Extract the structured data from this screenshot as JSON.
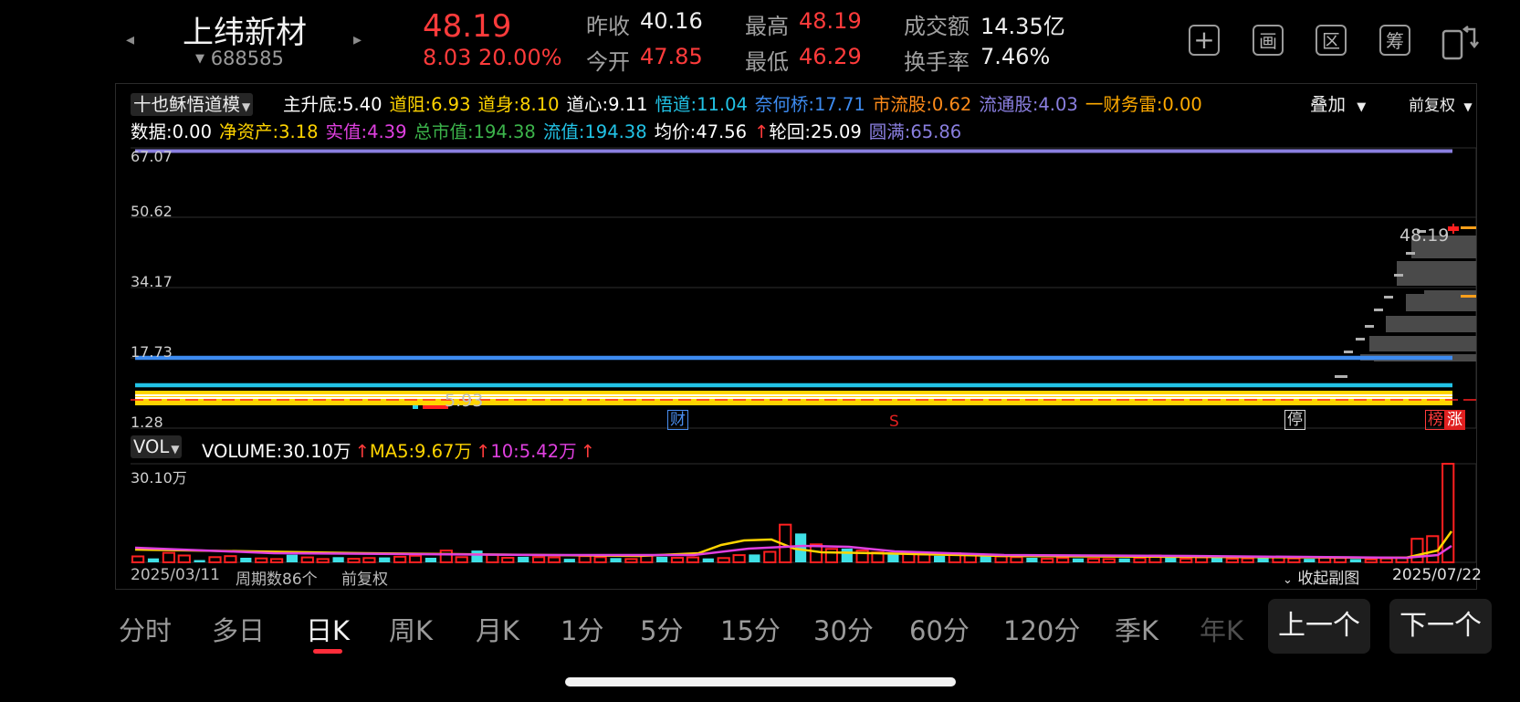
{
  "stock": {
    "name": "上纬新材",
    "code": "688585",
    "price": "48.19",
    "change": "8.03",
    "change_pct": "20.00%",
    "stats": [
      {
        "label": "昨收",
        "value": "40.16",
        "color": "#eeeeee"
      },
      {
        "label": "今开",
        "value": "47.85",
        "color": "#ff3b3b"
      },
      {
        "label": "最高",
        "value": "48.19",
        "color": "#ff3b3b"
      },
      {
        "label": "最低",
        "value": "46.29",
        "color": "#ff3b3b"
      },
      {
        "label": "成交额",
        "value": "14.35亿",
        "color": "#eeeeee"
      },
      {
        "label": "换手率",
        "value": "7.46%",
        "color": "#eeeeee"
      }
    ]
  },
  "toolbar": {
    "add_glyph": "+",
    "btn_picture": "画",
    "btn_interval": "区",
    "btn_chips": "筹"
  },
  "indicator": {
    "selector": "十也稣悟道模",
    "row1": [
      {
        "text": "主升底:5.40",
        "color": "#ffffff"
      },
      {
        "text": "道阻:6.93",
        "color": "#ffd400"
      },
      {
        "text": "道身:8.10",
        "color": "#ffd400"
      },
      {
        "text": "道心:9.11",
        "color": "#ffffff"
      },
      {
        "text": "悟道:11.04",
        "color": "#22c3e6"
      },
      {
        "text": "奈何桥:17.71",
        "color": "#3d8bf0"
      },
      {
        "text": "市流股:0.62",
        "color": "#ff8c1a"
      },
      {
        "text": "流通股:4.03",
        "color": "#8a7fe0"
      },
      {
        "text": "一财务雷:0.00",
        "color": "#ffaa00"
      }
    ],
    "row2": [
      {
        "text": "数据:0.00",
        "color": "#ffffff"
      },
      {
        "text": "净资产:3.18",
        "color": "#ffd400"
      },
      {
        "text": "实值:4.39",
        "color": "#e040e0"
      },
      {
        "text": "总市值:194.38",
        "color": "#3cb44b"
      },
      {
        "text": "流值:194.38",
        "color": "#22c3e6"
      },
      {
        "text": "均价:47.56",
        "color": "#ffffff"
      },
      {
        "text": "↑",
        "color": "#ff3b3b"
      },
      {
        "text": "轮回:25.09",
        "color": "#ffffff"
      },
      {
        "text": "圆满:65.86",
        "color": "#8a7fe0"
      }
    ],
    "overlay": "叠加",
    "adjust": "前复权"
  },
  "main_axis": {
    "labels": [
      "67.07",
      "50.62",
      "34.17",
      "17.73",
      "1.28"
    ],
    "last_price_label": "48.19",
    "low_label": "5.93"
  },
  "markers": {
    "cai": "财",
    "s": "S",
    "ting": "停",
    "bang": "榜",
    "zhang": "涨"
  },
  "volume": {
    "selector": "VOL",
    "legend": [
      {
        "text": "VOLUME:30.10万",
        "color": "#ffffff"
      },
      {
        "text": "↑",
        "color": "#ff3b3b"
      },
      {
        "text": "MA5:9.67万",
        "color": "#ffd400"
      },
      {
        "text": "↑",
        "color": "#ff3b3b"
      },
      {
        "text": "10:5.42万",
        "color": "#e040e0"
      },
      {
        "text": "↑",
        "color": "#ff3b3b"
      }
    ],
    "max_label": "30.10万"
  },
  "footer": {
    "start_date": "2025/03/11",
    "periods": "周期数86个",
    "adjust": "前复权",
    "collapse": "收起副图",
    "end_date": "2025/07/22"
  },
  "tabs": [
    "分时",
    "多日",
    "日K",
    "周K",
    "月K",
    "1分",
    "5分",
    "15分",
    "30分",
    "60分",
    "120分",
    "季K",
    "年K"
  ],
  "active_tab": "日K",
  "nav": {
    "prev": "上一个",
    "next": "下一个"
  },
  "chart_data": {
    "type": "bar",
    "title": "",
    "ylabel": "",
    "ylim": [
      0,
      30.1
    ],
    "y_unit": "万",
    "series": [
      {
        "name": "VOLUME",
        "values": [
          1.8,
          1.2,
          2.9,
          2.1,
          0.7,
          1.6,
          1.9,
          1.4,
          1.2,
          1.0,
          2.3,
          1.5,
          1.0,
          1.6,
          1.1,
          1.3,
          1.5,
          1.7,
          2.0,
          1.4,
          3.6,
          1.6,
          3.6,
          2.3,
          1.4,
          1.7,
          1.6,
          1.5,
          1.1,
          1.9,
          1.6,
          1.3,
          1.0,
          2.0,
          1.7,
          1.4,
          1.5,
          1.2,
          1.3,
          2.2,
          2.4,
          3.2,
          11.5,
          8.8,
          5.5,
          4.1,
          4.2,
          3.6,
          3.0,
          2.9,
          2.7,
          2.4,
          2.0,
          2.8,
          2.3,
          2.0,
          1.8,
          1.6,
          1.4,
          1.1,
          1.3,
          1.2,
          1.1,
          1.0,
          1.2,
          1.3,
          2.1,
          1.6,
          1.1,
          1.5,
          1.8,
          1.1,
          1.2,
          1.3,
          1.5,
          1.2,
          1.1,
          1.4,
          1.3,
          1.0,
          0.9,
          1.2,
          1.5,
          7.2,
          8.0,
          30.1
        ]
      }
    ]
  }
}
